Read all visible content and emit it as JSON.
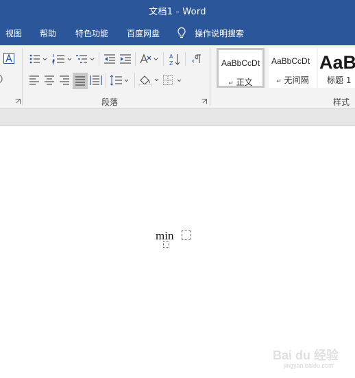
{
  "window": {
    "title": "文档1  -  Word"
  },
  "menu": {
    "tabs": [
      "视图",
      "帮助",
      "特色功能",
      "百度网盘"
    ],
    "search_label": "操作说明搜索"
  },
  "ribbon": {
    "paragraph_group_label": "段落",
    "styles_group_label": "样式",
    "styles": [
      {
        "sample": "AaBbCcDt",
        "name": "正文",
        "selected": true
      },
      {
        "sample": "AaBbCcDt",
        "name": "无间隔"
      },
      {
        "sample": "AaB",
        "name": "标题 1"
      }
    ]
  },
  "document": {
    "formula_text": "min"
  },
  "watermark": {
    "brand": "Bai du 经验",
    "url": "jingyan.baidu.com"
  },
  "colors": {
    "titlebar": "#2b579a",
    "ribbon_bg": "#f3f3f3",
    "strip_bg": "#e6e6e6"
  }
}
